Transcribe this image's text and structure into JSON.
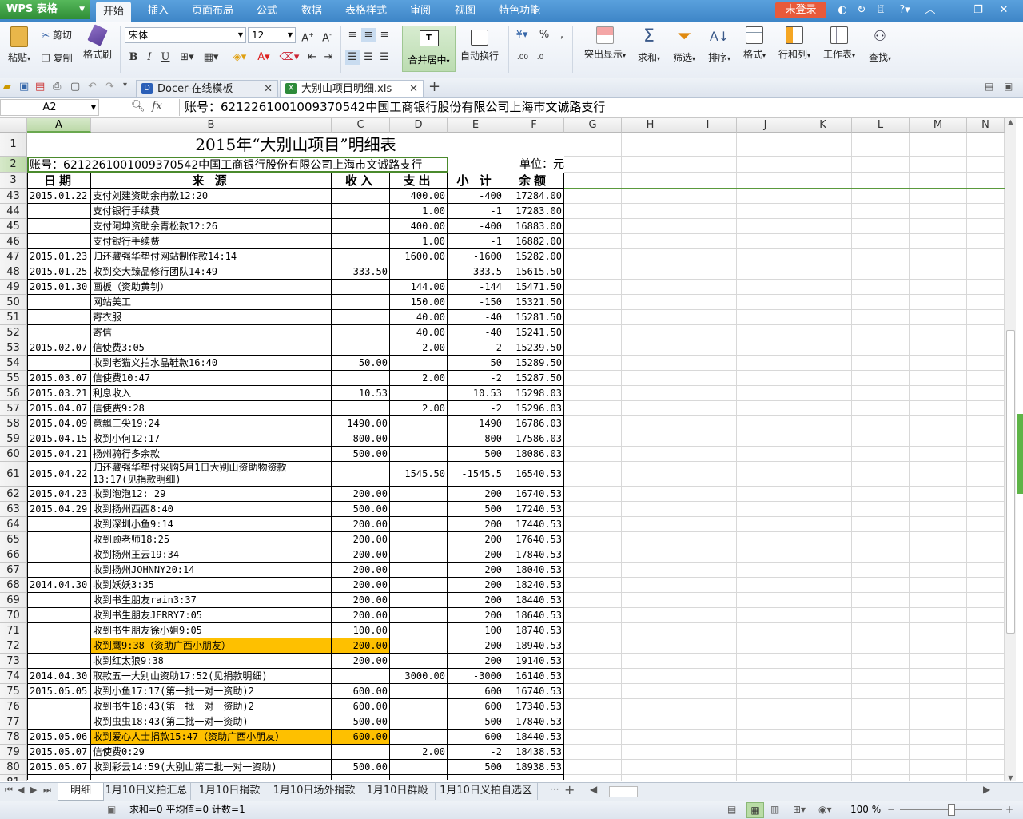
{
  "app": {
    "name": "WPS 表格",
    "login": "未登录"
  },
  "menu": [
    "开始",
    "插入",
    "页面布局",
    "公式",
    "数据",
    "表格样式",
    "审阅",
    "视图",
    "特色功能"
  ],
  "ribbon": {
    "paste": "粘贴",
    "cut": "剪切",
    "copy": "复制",
    "format_painter": "格式刷",
    "font": "宋体",
    "size": "12",
    "merge": "合并居中",
    "wrap": "自动换行",
    "percent": "%",
    "highlight": "突出显示",
    "sum": "求和",
    "filter": "筛选",
    "sort": "排序",
    "format": "格式",
    "rowcol": "行和列",
    "sheet": "工作表",
    "find": "查找"
  },
  "tabs": [
    {
      "label": "Docer-在线模板"
    },
    {
      "label": "大别山项目明细.xls"
    }
  ],
  "formula": {
    "cellref": "A2",
    "fx": "fx",
    "content": "账号：6212261001009370542中国工商银行股份有限公司上海市文诚路支行"
  },
  "columns": [
    "A",
    "B",
    "C",
    "D",
    "E",
    "F",
    "G",
    "H",
    "I",
    "J",
    "K",
    "L",
    "M",
    "N"
  ],
  "sheet": {
    "title": "2015年“大别山项目”明细表",
    "account": "账号：6212261001009370542中国工商银行股份有限公司上海市文诚路支行",
    "unit": "单位：元",
    "headers": [
      "日期",
      "来 源",
      "收入",
      "支出",
      "小 计",
      "余额"
    ],
    "rows": [
      {
        "n": "43",
        "d": "2015.01.22",
        "s": "支付刘建资助余冉款12:20",
        "i": "",
        "o": "400.00",
        "t": "-400",
        "b": "17284.00"
      },
      {
        "n": "44",
        "d": "",
        "s": "支付银行手续费",
        "i": "",
        "o": "1.00",
        "t": "-1",
        "b": "17283.00"
      },
      {
        "n": "45",
        "d": "",
        "s": "支付阿坤资助余青松款12:26",
        "i": "",
        "o": "400.00",
        "t": "-400",
        "b": "16883.00"
      },
      {
        "n": "46",
        "d": "",
        "s": "支付银行手续费",
        "i": "",
        "o": "1.00",
        "t": "-1",
        "b": "16882.00"
      },
      {
        "n": "47",
        "d": "2015.01.23",
        "s": "归还藏强华垫付网站制作款14:14",
        "i": "",
        "o": "1600.00",
        "t": "-1600",
        "b": "15282.00"
      },
      {
        "n": "48",
        "d": "2015.01.25",
        "s": "收到交大臻品修行团队14:49",
        "i": "333.50",
        "o": "",
        "t": "333.5",
        "b": "15615.50"
      },
      {
        "n": "49",
        "d": "2015.01.30",
        "s": "画板（资助黄钊）",
        "i": "",
        "o": "144.00",
        "t": "-144",
        "b": "15471.50"
      },
      {
        "n": "50",
        "d": "",
        "s": "网站美工",
        "i": "",
        "o": "150.00",
        "t": "-150",
        "b": "15321.50"
      },
      {
        "n": "51",
        "d": "",
        "s": "寄衣服",
        "i": "",
        "o": "40.00",
        "t": "-40",
        "b": "15281.50"
      },
      {
        "n": "52",
        "d": "",
        "s": "寄信",
        "i": "",
        "o": "40.00",
        "t": "-40",
        "b": "15241.50"
      },
      {
        "n": "53",
        "d": "2015.02.07",
        "s": "信使费3:05",
        "i": "",
        "o": "2.00",
        "t": "-2",
        "b": "15239.50"
      },
      {
        "n": "54",
        "d": "",
        "s": "收到老猫义拍水晶鞋款16:40",
        "i": "50.00",
        "o": "",
        "t": "50",
        "b": "15289.50"
      },
      {
        "n": "55",
        "d": "2015.03.07",
        "s": "信使费10:47",
        "i": "",
        "o": "2.00",
        "t": "-2",
        "b": "15287.50"
      },
      {
        "n": "56",
        "d": "2015.03.21",
        "s": "利息收入",
        "i": "10.53",
        "o": "",
        "t": "10.53",
        "b": "15298.03"
      },
      {
        "n": "57",
        "d": "2015.04.07",
        "s": "信使费9:28",
        "i": "",
        "o": "2.00",
        "t": "-2",
        "b": "15296.03"
      },
      {
        "n": "58",
        "d": "2015.04.09",
        "s": "意飘三尖19:24",
        "i": "1490.00",
        "o": "",
        "t": "1490",
        "b": "16786.03"
      },
      {
        "n": "59",
        "d": "2015.04.15",
        "s": "收到小何12:17",
        "i": "800.00",
        "o": "",
        "t": "800",
        "b": "17586.03"
      },
      {
        "n": "60",
        "d": "2015.04.21",
        "s": "扬州骑行多余款",
        "i": "500.00",
        "o": "",
        "t": "500",
        "b": "18086.03"
      },
      {
        "n": "61",
        "d": "2015.04.22",
        "s": "归还藏强华垫付采购5月1日大别山资助物资款",
        "s2": "13:17(见捐款明细)",
        "i": "",
        "o": "1545.50",
        "t": "-1545.5",
        "b": "16540.53",
        "tall": true
      },
      {
        "n": "62",
        "d": "2015.04.23",
        "s": "收到泡泡12: 29",
        "i": "200.00",
        "o": "",
        "t": "200",
        "b": "16740.53"
      },
      {
        "n": "63",
        "d": "2015.04.29",
        "s": "收到扬州西西8:40",
        "i": "500.00",
        "o": "",
        "t": "500",
        "b": "17240.53"
      },
      {
        "n": "64",
        "d": "",
        "s": "收到深圳小鱼9:14",
        "i": "200.00",
        "o": "",
        "t": "200",
        "b": "17440.53"
      },
      {
        "n": "65",
        "d": "",
        "s": "收到顾老师18:25",
        "i": "200.00",
        "o": "",
        "t": "200",
        "b": "17640.53"
      },
      {
        "n": "66",
        "d": "",
        "s": "收到扬州王云19:34",
        "i": "200.00",
        "o": "",
        "t": "200",
        "b": "17840.53"
      },
      {
        "n": "67",
        "d": "",
        "s": "收到扬州JOHNNY20:14",
        "i": "200.00",
        "o": "",
        "t": "200",
        "b": "18040.53"
      },
      {
        "n": "68",
        "d": "2014.04.30",
        "s": "收到妖妖3:35",
        "i": "200.00",
        "o": "",
        "t": "200",
        "b": "18240.53"
      },
      {
        "n": "69",
        "d": "",
        "s": "收到书生朋友rain3:37",
        "i": "200.00",
        "o": "",
        "t": "200",
        "b": "18440.53"
      },
      {
        "n": "70",
        "d": "",
        "s": "收到书生朋友JERRY7:05",
        "i": "200.00",
        "o": "",
        "t": "200",
        "b": "18640.53"
      },
      {
        "n": "71",
        "d": "",
        "s": "收到书生朋友徐小姐9:05",
        "i": "100.00",
        "o": "",
        "t": "100",
        "b": "18740.53"
      },
      {
        "n": "72",
        "d": "",
        "s": "收到鹰9:38（资助广西小朋友）",
        "i": "200.00",
        "o": "",
        "t": "200",
        "b": "18940.53",
        "hl": true
      },
      {
        "n": "73",
        "d": "",
        "s": "收到红太狼9:38",
        "i": "200.00",
        "o": "",
        "t": "200",
        "b": "19140.53"
      },
      {
        "n": "74",
        "d": "2014.04.30",
        "s": "取款五一大别山资助17:52(见捐款明细)",
        "i": "",
        "o": "3000.00",
        "t": "-3000",
        "b": "16140.53"
      },
      {
        "n": "75",
        "d": "2015.05.05",
        "s": "收到小鱼17:17(第一批一对一资助)2",
        "i": "600.00",
        "o": "",
        "t": "600",
        "b": "16740.53"
      },
      {
        "n": "76",
        "d": "",
        "s": "收到书生18:43(第一批一对一资助)2",
        "i": "600.00",
        "o": "",
        "t": "600",
        "b": "17340.53"
      },
      {
        "n": "77",
        "d": "",
        "s": "收到虫虫18:43(第二批一对一资助)",
        "i": "500.00",
        "o": "",
        "t": "500",
        "b": "17840.53"
      },
      {
        "n": "78",
        "d": "2015.05.06",
        "s": "收到爱心人士捐款15:47（资助广西小朋友）",
        "i": "600.00",
        "o": "",
        "t": "600",
        "b": "18440.53",
        "hl": true
      },
      {
        "n": "79",
        "d": "2015.05.07",
        "s": "信使费0:29",
        "i": "",
        "o": "2.00",
        "t": "-2",
        "b": "18438.53"
      },
      {
        "n": "80",
        "d": "2015.05.07",
        "s": "收到彩云14:59(大别山第二批一对一资助)",
        "i": "500.00",
        "o": "",
        "t": "500",
        "b": "18938.53"
      }
    ]
  },
  "sheet_tabs": [
    "明细",
    "1月10日义拍汇总",
    "1月10日捐款",
    "1月10日场外捐款",
    "1月10日群殿",
    "1月10日义拍自选区"
  ],
  "status": {
    "text": "求和=0  平均值=0  计数=1",
    "zoom": "100 %"
  }
}
